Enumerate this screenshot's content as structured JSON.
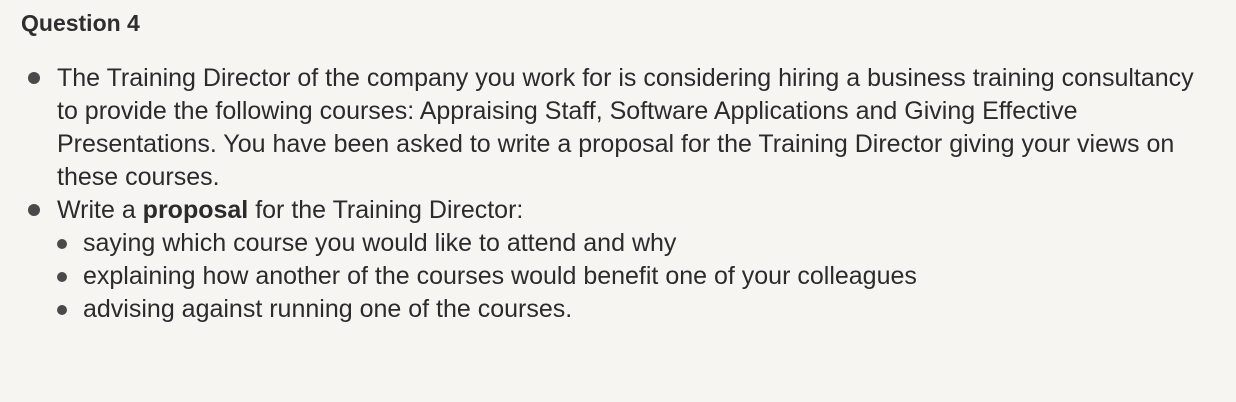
{
  "question": {
    "title": "Question 4"
  },
  "bullets": [
    {
      "text": "The Training Director of the company you work for is considering hiring a business training consultancy to provide the following courses: Appraising Staff, Software Applications and Giving Effective Presentations. You have been asked to write a proposal for the Training Director giving your views on these courses."
    },
    {
      "text_before": "Write a ",
      "bold_text": "proposal",
      "text_after": " for the Training Director:",
      "sub_items": [
        "saying which course you would like to attend and why",
        "explaining how another of the courses would benefit one of your colleagues",
        "advising against running one of the courses."
      ]
    }
  ]
}
